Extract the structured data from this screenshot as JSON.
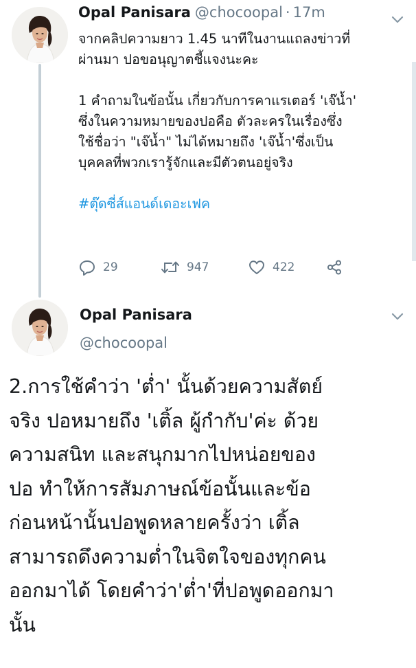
{
  "tweet1": {
    "author_name": "Opal Panisara",
    "handle": "@chocoopal",
    "separator": "·",
    "time": "17m",
    "paragraph1": [
      "จากคลิปความยาว 1.45 นาทีในงานแถลงข่าวที่",
      "ผ่านมา ปอขอนุญาตชี้แจงนะคะ"
    ],
    "paragraph2": [
      "1 คำถามในข้อนั้น เกี่ยวกับการคาแรเตอร์ 'เจ๊น้ำ'",
      "ซึ่งในความหมายของปอคือ ตัวละครในเรื่องซึ่ง",
      "ใช้ชื่อว่า \"เจ๊น้ำ\" ไม่ได้หมายถึง 'เจ๊น้ำ'ซึ่งเป็น",
      "บุคคลที่พวกเรารู้จักและมีตัวตนอยู่จริง"
    ],
    "hashtag": "#ตุ๊ดซี่ส์แอนด์เดอะเฟค",
    "reply_count": "29",
    "retweet_count": "947",
    "like_count": "422"
  },
  "tweet2": {
    "author_name": "Opal Panisara",
    "handle": "@chocoopal",
    "lines": [
      "2.การใช้คำว่า 'ต่ำ' นั้นด้วยความสัตย์",
      "จริง ปอหมายถึง 'เติ้ล ผู้กำกับ'ค่ะ ด้วย",
      "ความสนิท และสนุกมากไปหน่อยของ",
      "ปอ ทำให้การสัมภาษณ์ข้อนั้นและข้อ",
      "ก่อนหน้านั้นปอพูดหลายครั้งว่า เติ้ล",
      "สามารถดึงความต่ำในจิตใจของทุกคน",
      "ออกมาได้ โดยคำว่า'ต่ำ'ที่ปอพูดออกมา",
      "นั้น"
    ]
  },
  "icons": {
    "reply": "reply-icon",
    "retweet": "retweet-icon",
    "like": "heart-icon",
    "share": "share-icon",
    "menu": "chevron-down-icon"
  },
  "colors": {
    "text": "#14171a",
    "secondary": "#657786",
    "link": "#1b95e0",
    "thread_line": "#c4cfd6"
  }
}
